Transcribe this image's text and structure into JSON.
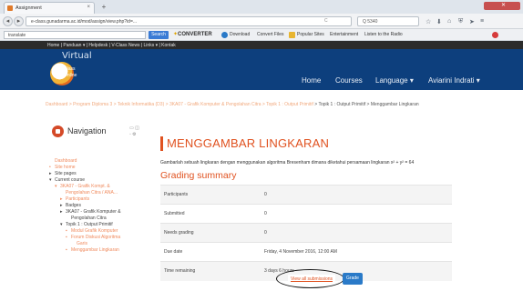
{
  "browser": {
    "tab_title": "Assignment",
    "tab_close": "×",
    "new_tab": "+",
    "url": "e-class.gunadarma.ac.id/mod/assign/view.php?id=...",
    "url_ctrl": "C",
    "search_value": "Q 5340",
    "toolbar_search_value": "translate",
    "toolbar_search_button": "Search",
    "converter_brand": "CONVERTER",
    "toolbar_links": [
      "Download",
      "Convert Files",
      "Popular Sites",
      "Entertainment",
      "Listen to the Radio"
    ]
  },
  "site": {
    "topbar": "Home | Panduan ▾ | Helpdesk | V-Class News | Links ▾ | Kontak",
    "logo_text": "Virtual",
    "logo_sub1": "Class",
    "logo_sub2": "Online",
    "nav": {
      "home": "Home",
      "courses": "Courses",
      "language": "Language ▾",
      "user": "Aviarini Indrati ▾"
    }
  },
  "breadcrumb": {
    "path": "Dashboard > Program Diploma 3 > Teknik Informatika (D3) > 3KA07 - Grafik Komputer & Pengolahan Citra > Topik 1 : Output Primitif",
    "current": "> Topik 1 : Output Primitif > Menggambar Lingkaran"
  },
  "navigation": {
    "title": "Navigation",
    "controls": "▭ ◫\n◦ ⚙ ▾",
    "items": [
      {
        "label": "Dashboard",
        "bullet": "",
        "cls": "o",
        "indent": 0
      },
      {
        "label": "Site home",
        "bullet": "•",
        "cls": "o",
        "indent": 0
      },
      {
        "label": "Site pages",
        "bullet": "▸",
        "cls": "d",
        "indent": 0
      },
      {
        "label": "Current course",
        "bullet": "▾",
        "cls": "d",
        "indent": 0
      },
      {
        "label": "3KA07 - Grafik Kompt. &",
        "bullet": "▾",
        "cls": "o",
        "indent": 6
      },
      {
        "label": "Pengolahan Citra / ANA...",
        "bullet": "",
        "cls": "o",
        "indent": 12
      },
      {
        "label": "Participants",
        "bullet": "▸",
        "cls": "o",
        "indent": 12
      },
      {
        "label": "Badges",
        "bullet": "▸",
        "cls": "d",
        "indent": 12
      },
      {
        "label": "3KA07 - Grafik Komputer &",
        "bullet": "▸",
        "cls": "d",
        "indent": 12
      },
      {
        "label": "Pengolahan Citra",
        "bullet": "",
        "cls": "d",
        "indent": 18
      },
      {
        "label": "Topik 1 : Output Primitif",
        "bullet": "▾",
        "cls": "d",
        "indent": 12
      },
      {
        "label": "Modul Grafik Komputer",
        "bullet": "▪",
        "cls": "o",
        "indent": 18
      },
      {
        "label": "Forum Diskusi Algoritma",
        "bullet": "▪",
        "cls": "o",
        "indent": 18
      },
      {
        "label": "Garis",
        "bullet": "",
        "cls": "o",
        "indent": 24
      },
      {
        "label": "Menggambar Lingkaran",
        "bullet": "▪",
        "cls": "o",
        "indent": 18
      }
    ]
  },
  "main": {
    "title": "MENGGAMBAR LINGKARAN",
    "description": "Gambarlah sebuah lingkaran dengan menggunakan algoritma Bresenham dimana diketahui persamaan lingkaran x² + y² = 64",
    "summary_heading": "Grading summary",
    "summary_rows": [
      {
        "key": "Participants",
        "value": "0"
      },
      {
        "key": "Submitted",
        "value": "0"
      },
      {
        "key": "Needs grading",
        "value": "0"
      },
      {
        "key": "Due date",
        "value": "Friday, 4 November 2016, 12:00 AM"
      },
      {
        "key": "Time remaining",
        "value": "3 days 6 hours"
      }
    ],
    "view_all": "View all submissions",
    "grade": "Grade"
  }
}
